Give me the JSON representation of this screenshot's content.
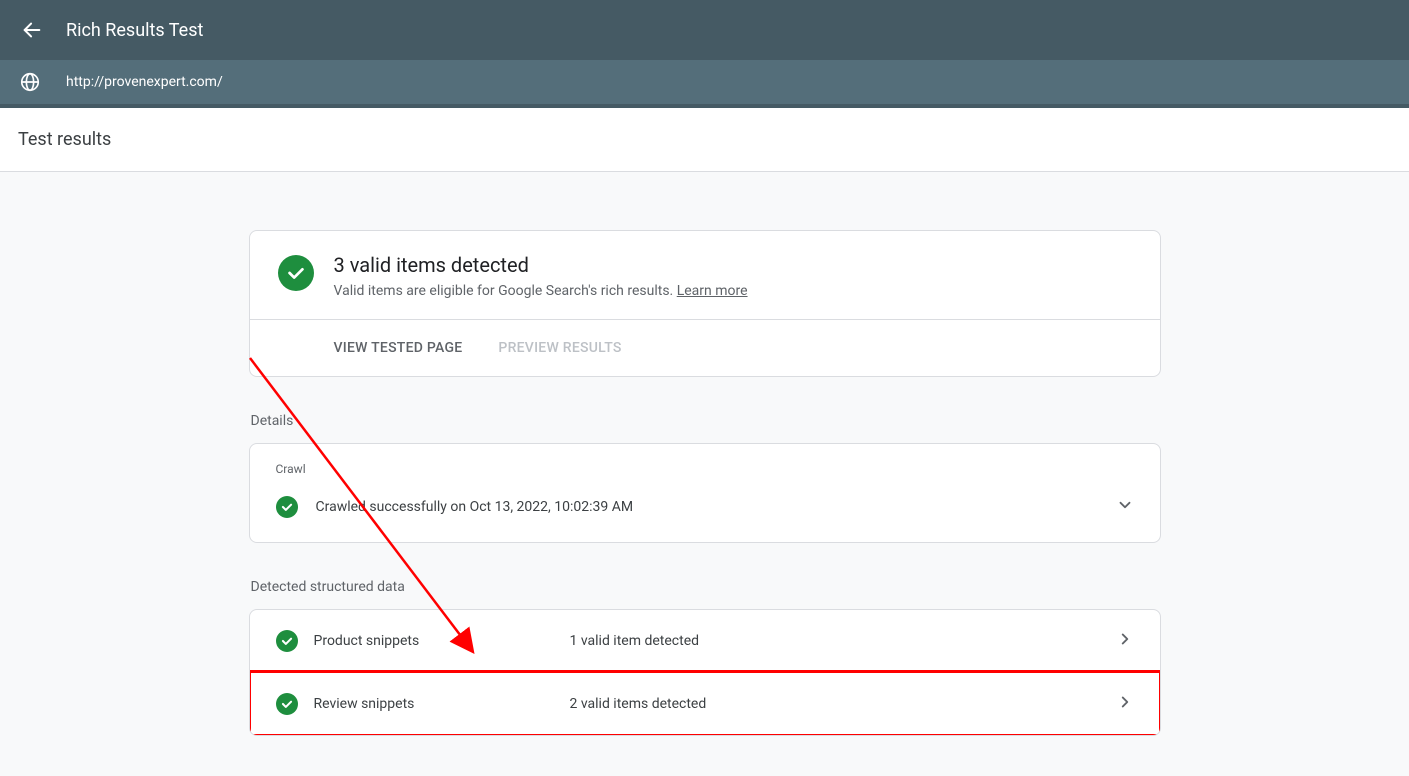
{
  "header": {
    "title": "Rich Results Test",
    "url": "http://provenexpert.com/"
  },
  "tabs": {
    "results": "Test results"
  },
  "summary": {
    "title": "3 valid items detected",
    "subtitle_prefix": "Valid items are eligible for Google Search's rich results. ",
    "learn_more": "Learn more"
  },
  "actions": {
    "view_page": "VIEW TESTED PAGE",
    "preview_results": "PREVIEW RESULTS"
  },
  "sections": {
    "details": "Details",
    "structured_data": "Detected structured data"
  },
  "crawl": {
    "label": "Crawl",
    "status": "Crawled successfully on Oct 13, 2022, 10:02:39 AM"
  },
  "items": [
    {
      "name": "Product snippets",
      "status": "1 valid item detected"
    },
    {
      "name": "Review snippets",
      "status": "2 valid items detected"
    }
  ]
}
